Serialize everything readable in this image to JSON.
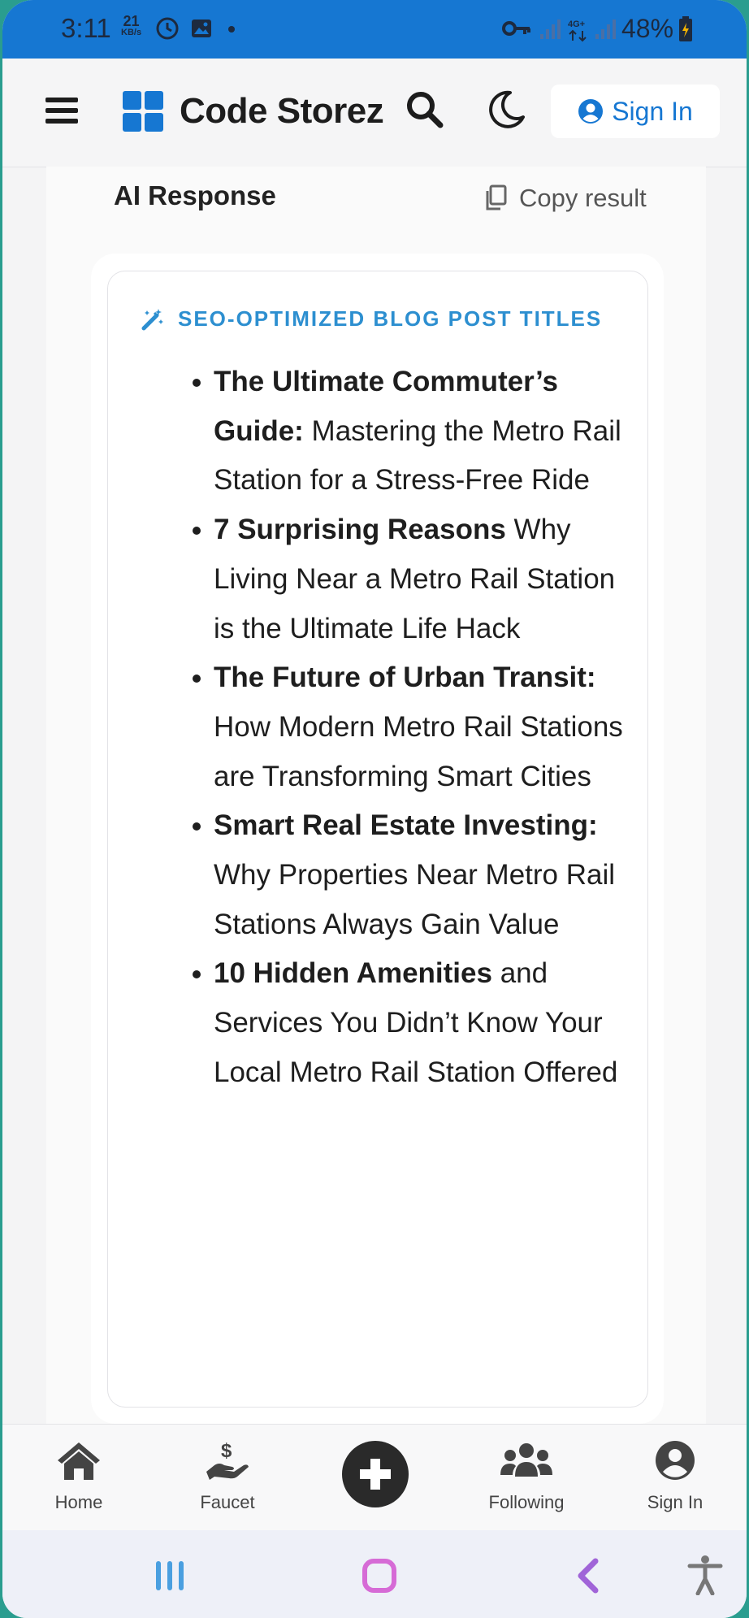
{
  "status_bar": {
    "time": "3:11",
    "net_speed": "21",
    "net_unit": "KB/s",
    "battery": "48%"
  },
  "header": {
    "brand": "Code Storez",
    "sign_in_label": "Sign In"
  },
  "result": {
    "heading": "AI Response",
    "copy_label": "Copy result",
    "card_title": "SEO-OPTIMIZED BLOG POST TITLES",
    "items": [
      {
        "bold": "The Ultimate Commuter’s Guide:",
        "rest": " Mastering the Metro Rail Station for a Stress-Free Ride"
      },
      {
        "bold": "7 Surprising Reasons",
        "rest": " Why Living Near a Metro Rail Station is the Ultimate Life Hack"
      },
      {
        "bold": "The Future of Urban Transit:",
        "rest": " How Modern Metro Rail Stations are Transforming Smart Cities"
      },
      {
        "bold": "Smart Real Estate Investing:",
        "rest": " Why Properties Near Metro Rail Stations Always Gain Value"
      },
      {
        "bold": "10 Hidden Amenities",
        "rest": " and Services You Didn’t Know Your Local Metro Rail Station Offered"
      }
    ]
  },
  "bottom_nav": {
    "home": "Home",
    "faucet": "Faucet",
    "following": "Following",
    "sign_in": "Sign In"
  },
  "colors": {
    "accent": "#1677d2",
    "card_title": "#2d8fd0",
    "fab": "#2a2a2a"
  }
}
